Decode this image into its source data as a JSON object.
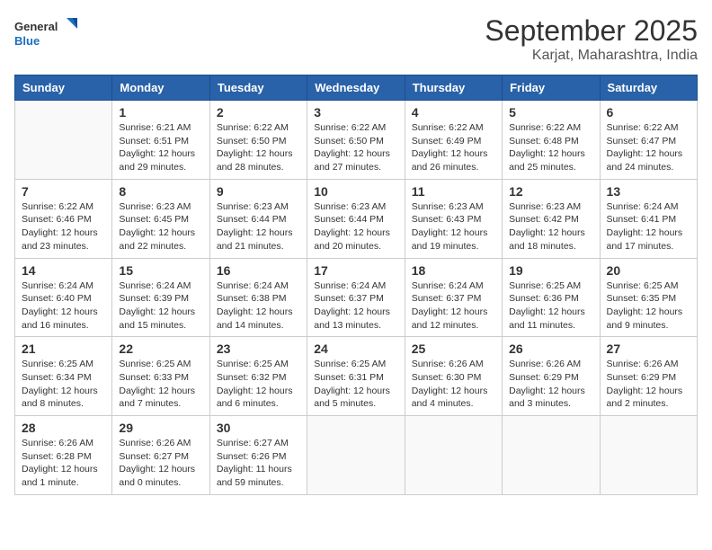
{
  "logo": {
    "line1": "General",
    "line2": "Blue"
  },
  "title": "September 2025",
  "location": "Karjat, Maharashtra, India",
  "days_header": [
    "Sunday",
    "Monday",
    "Tuesday",
    "Wednesday",
    "Thursday",
    "Friday",
    "Saturday"
  ],
  "weeks": [
    [
      {
        "day": "",
        "info": ""
      },
      {
        "day": "1",
        "info": "Sunrise: 6:21 AM\nSunset: 6:51 PM\nDaylight: 12 hours\nand 29 minutes."
      },
      {
        "day": "2",
        "info": "Sunrise: 6:22 AM\nSunset: 6:50 PM\nDaylight: 12 hours\nand 28 minutes."
      },
      {
        "day": "3",
        "info": "Sunrise: 6:22 AM\nSunset: 6:50 PM\nDaylight: 12 hours\nand 27 minutes."
      },
      {
        "day": "4",
        "info": "Sunrise: 6:22 AM\nSunset: 6:49 PM\nDaylight: 12 hours\nand 26 minutes."
      },
      {
        "day": "5",
        "info": "Sunrise: 6:22 AM\nSunset: 6:48 PM\nDaylight: 12 hours\nand 25 minutes."
      },
      {
        "day": "6",
        "info": "Sunrise: 6:22 AM\nSunset: 6:47 PM\nDaylight: 12 hours\nand 24 minutes."
      }
    ],
    [
      {
        "day": "7",
        "info": "Sunrise: 6:22 AM\nSunset: 6:46 PM\nDaylight: 12 hours\nand 23 minutes."
      },
      {
        "day": "8",
        "info": "Sunrise: 6:23 AM\nSunset: 6:45 PM\nDaylight: 12 hours\nand 22 minutes."
      },
      {
        "day": "9",
        "info": "Sunrise: 6:23 AM\nSunset: 6:44 PM\nDaylight: 12 hours\nand 21 minutes."
      },
      {
        "day": "10",
        "info": "Sunrise: 6:23 AM\nSunset: 6:44 PM\nDaylight: 12 hours\nand 20 minutes."
      },
      {
        "day": "11",
        "info": "Sunrise: 6:23 AM\nSunset: 6:43 PM\nDaylight: 12 hours\nand 19 minutes."
      },
      {
        "day": "12",
        "info": "Sunrise: 6:23 AM\nSunset: 6:42 PM\nDaylight: 12 hours\nand 18 minutes."
      },
      {
        "day": "13",
        "info": "Sunrise: 6:24 AM\nSunset: 6:41 PM\nDaylight: 12 hours\nand 17 minutes."
      }
    ],
    [
      {
        "day": "14",
        "info": "Sunrise: 6:24 AM\nSunset: 6:40 PM\nDaylight: 12 hours\nand 16 minutes."
      },
      {
        "day": "15",
        "info": "Sunrise: 6:24 AM\nSunset: 6:39 PM\nDaylight: 12 hours\nand 15 minutes."
      },
      {
        "day": "16",
        "info": "Sunrise: 6:24 AM\nSunset: 6:38 PM\nDaylight: 12 hours\nand 14 minutes."
      },
      {
        "day": "17",
        "info": "Sunrise: 6:24 AM\nSunset: 6:37 PM\nDaylight: 12 hours\nand 13 minutes."
      },
      {
        "day": "18",
        "info": "Sunrise: 6:24 AM\nSunset: 6:37 PM\nDaylight: 12 hours\nand 12 minutes."
      },
      {
        "day": "19",
        "info": "Sunrise: 6:25 AM\nSunset: 6:36 PM\nDaylight: 12 hours\nand 11 minutes."
      },
      {
        "day": "20",
        "info": "Sunrise: 6:25 AM\nSunset: 6:35 PM\nDaylight: 12 hours\nand 9 minutes."
      }
    ],
    [
      {
        "day": "21",
        "info": "Sunrise: 6:25 AM\nSunset: 6:34 PM\nDaylight: 12 hours\nand 8 minutes."
      },
      {
        "day": "22",
        "info": "Sunrise: 6:25 AM\nSunset: 6:33 PM\nDaylight: 12 hours\nand 7 minutes."
      },
      {
        "day": "23",
        "info": "Sunrise: 6:25 AM\nSunset: 6:32 PM\nDaylight: 12 hours\nand 6 minutes."
      },
      {
        "day": "24",
        "info": "Sunrise: 6:25 AM\nSunset: 6:31 PM\nDaylight: 12 hours\nand 5 minutes."
      },
      {
        "day": "25",
        "info": "Sunrise: 6:26 AM\nSunset: 6:30 PM\nDaylight: 12 hours\nand 4 minutes."
      },
      {
        "day": "26",
        "info": "Sunrise: 6:26 AM\nSunset: 6:29 PM\nDaylight: 12 hours\nand 3 minutes."
      },
      {
        "day": "27",
        "info": "Sunrise: 6:26 AM\nSunset: 6:29 PM\nDaylight: 12 hours\nand 2 minutes."
      }
    ],
    [
      {
        "day": "28",
        "info": "Sunrise: 6:26 AM\nSunset: 6:28 PM\nDaylight: 12 hours\nand 1 minute."
      },
      {
        "day": "29",
        "info": "Sunrise: 6:26 AM\nSunset: 6:27 PM\nDaylight: 12 hours\nand 0 minutes."
      },
      {
        "day": "30",
        "info": "Sunrise: 6:27 AM\nSunset: 6:26 PM\nDaylight: 11 hours\nand 59 minutes."
      },
      {
        "day": "",
        "info": ""
      },
      {
        "day": "",
        "info": ""
      },
      {
        "day": "",
        "info": ""
      },
      {
        "day": "",
        "info": ""
      }
    ]
  ]
}
